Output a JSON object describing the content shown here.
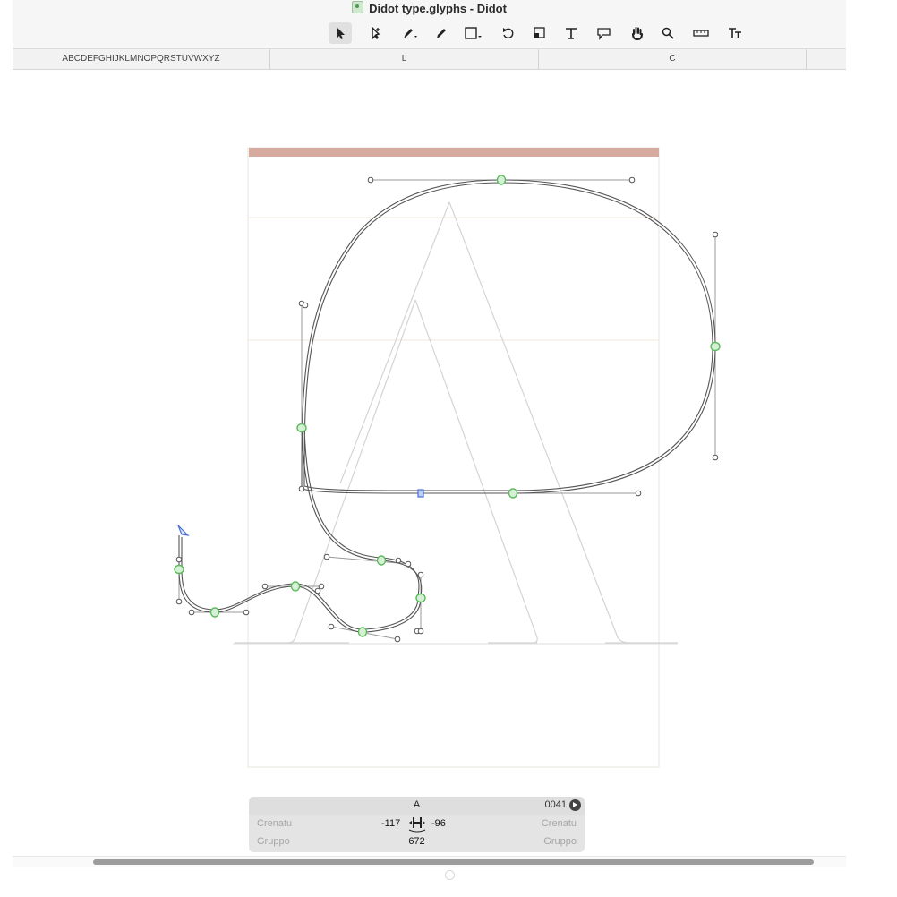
{
  "window": {
    "title": "Didot type.glyphs - Didot",
    "doc_icon": "glyphs-document-icon"
  },
  "toolbar": {
    "tools": [
      {
        "name": "select-tool",
        "icon": "arrow-pointer-icon",
        "active": true
      },
      {
        "name": "select-all-layers-tool",
        "icon": "pointer-plus-icon"
      },
      {
        "name": "draw-tool",
        "icon": "pen-icon"
      },
      {
        "name": "pencil-tool",
        "icon": "pencil-icon"
      },
      {
        "name": "primitives-tool",
        "icon": "rectangle-icon"
      },
      {
        "name": "rotate-tool",
        "icon": "rotate-icon"
      },
      {
        "name": "scale-tool",
        "icon": "scale-icon"
      },
      {
        "name": "text-tool",
        "icon": "text-t-icon"
      },
      {
        "name": "annotation-tool",
        "icon": "speech-bubble-icon"
      },
      {
        "name": "hand-tool",
        "icon": "hand-icon"
      },
      {
        "name": "zoom-tool",
        "icon": "magnifier-icon"
      },
      {
        "name": "measurement-tool",
        "icon": "ruler-icon"
      },
      {
        "name": "type-case-tool",
        "icon": "text-size-icon"
      }
    ]
  },
  "tabs": [
    {
      "label": "ABCDEFGHIJKLMNOPQRSTUVWXYZ"
    },
    {
      "label": "L"
    },
    {
      "label": "C"
    }
  ],
  "glyph": {
    "name": "A",
    "unicode": "0041",
    "left_kern_label": "Crenatu",
    "right_kern_label": "Crenatu",
    "left_group_label": "Gruppo",
    "right_group_label": "Gruppo",
    "lsb": "-117",
    "rsb": "-96",
    "width": "672"
  },
  "colors": {
    "ascender_band": "#d7aaa0",
    "metric_lines": "#ece9d8",
    "node_green": "#5dbb5d",
    "node_blue": "#4a6fd6",
    "outline": "#555555",
    "background_glyph": "#d4d4d4"
  }
}
